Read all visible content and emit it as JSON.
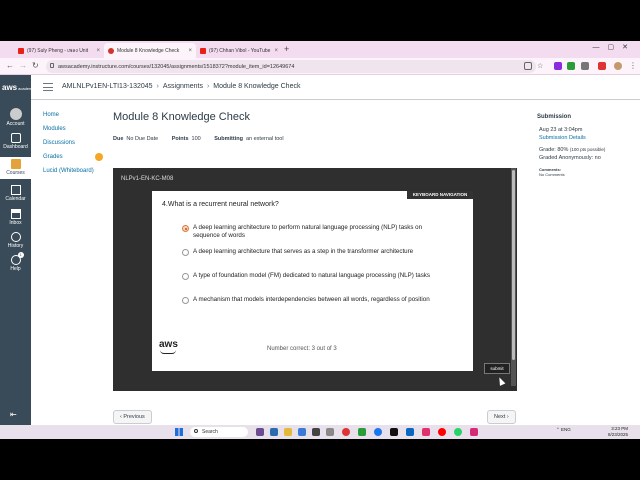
{
  "browser": {
    "tabs": [
      {
        "label": "(97) Suly Pheng - เพลง Unit",
        "active": false,
        "icon": "youtube-icon"
      },
      {
        "label": "Module 8 Knowledge Check",
        "active": true,
        "icon": "canvas-icon"
      },
      {
        "label": "(97) Chhan Vibol - YouTube",
        "active": false,
        "icon": "youtube-icon"
      }
    ],
    "new_tab": "+",
    "url": "awsacademy.instructure.com/courses/132045/assignments/1518372?module_item_id=12649674"
  },
  "global_nav": {
    "logo": "aws",
    "logo_sub": "academy",
    "items": [
      {
        "label": "Account",
        "icon": "account-icon"
      },
      {
        "label": "Dashboard",
        "icon": "dashboard-icon"
      },
      {
        "label": "Courses",
        "icon": "courses-icon",
        "active": true
      },
      {
        "label": "Calendar",
        "icon": "calendar-icon"
      },
      {
        "label": "Inbox",
        "icon": "inbox-icon"
      },
      {
        "label": "History",
        "icon": "history-icon",
        "badge": "1"
      },
      {
        "label": "Help",
        "icon": "help-icon"
      }
    ],
    "collapse_icon": "collapse-icon"
  },
  "breadcrumb": {
    "course": "AMLNLPv1EN-LTI13-132045",
    "section": "Assignments",
    "page": "Module 8 Knowledge Check"
  },
  "course_nav": [
    {
      "label": "Home"
    },
    {
      "label": "Modules"
    },
    {
      "label": "Discussions"
    },
    {
      "label": "Grades",
      "badge": true
    },
    {
      "label": "Lucid (Whiteboard)"
    }
  ],
  "assignment": {
    "title": "Module 8 Knowledge Check",
    "due_label": "Due",
    "due_value": "No Due Date",
    "points_label": "Points",
    "points_value": "100",
    "submitting_label": "Submitting",
    "submitting_value": "an external tool"
  },
  "tool": {
    "name": "NLPv1-EN-KC-M08",
    "keyboard_nav": "KEYBOARD NAVIGATION",
    "question": "4.What is a recurrent neural network?",
    "options": [
      {
        "text": "A deep learning architecture to perform natural language processing (NLP) tasks on sequence of words",
        "selected": true
      },
      {
        "text": "A deep learning architecture that serves as a step in the transformer architecture",
        "selected": false
      },
      {
        "text": "A type of foundation model (FM) dedicated to natural language processing (NLP) tasks",
        "selected": false
      },
      {
        "text": "A mechanism that models interdependencies between all words, regardless of position",
        "selected": false
      }
    ],
    "logo": "aws",
    "score": "Number correct: 3 out of 3",
    "submit": "submit"
  },
  "pager": {
    "prev": "‹ Previous",
    "next": "Next ›"
  },
  "submission": {
    "heading": "Submission",
    "date": "Aug 23 at 3:04pm",
    "details_link": "Submission Details",
    "grade": "Grade: 80%",
    "grade_note": "(100 pts possible)",
    "anonymous": "Graded Anonymously: no",
    "comments_label": "Comments:",
    "comments_value": "No Comments"
  },
  "taskbar": {
    "search_placeholder": "Search",
    "language": "ENG",
    "time": "3:23 PM",
    "date": "8/23/2025"
  }
}
